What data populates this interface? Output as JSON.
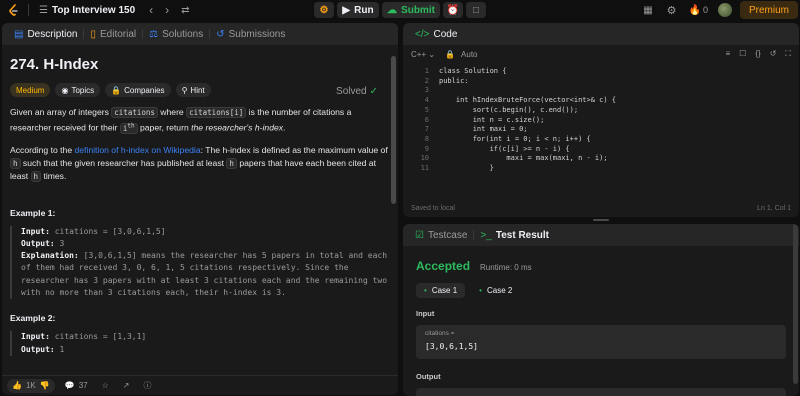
{
  "topbar": {
    "title": "Top Interview 150",
    "run_label": "Run",
    "submit_label": "Submit",
    "streak": "0",
    "premium_label": "Premium"
  },
  "left": {
    "tabs": [
      "Description",
      "Editorial",
      "Solutions",
      "Submissions"
    ],
    "problem_title": "274. H-Index",
    "status": "Solved",
    "tags": {
      "difficulty": "Medium",
      "topics": "Topics",
      "companies": "Companies",
      "hint": "Hint"
    },
    "para1": {
      "t1": "Given an array of integers ",
      "c1": "citations",
      "t2": " where ",
      "c2": "citations[i]",
      "t3": " is the number of citations a researcher received for their ",
      "c3": "i",
      "sup": "th",
      "t4": " paper, return ",
      "em": "the researcher's h-index",
      "t5": "."
    },
    "para2": {
      "t1": "According to the ",
      "link": "definition of h-index on Wikipedia",
      "t2": ": The h-index is defined as the maximum value of ",
      "c1": "h",
      "t3": " such that the given researcher has published at least ",
      "c2": "h",
      "t4": " papers that have each been cited at least ",
      "c3": "h",
      "t5": " times."
    },
    "example1": {
      "title": "Example 1:",
      "input_label": "Input:",
      "input_value": "citations = [3,0,6,1,5]",
      "output_label": "Output:",
      "output_value": "3",
      "explanation_label": "Explanation:",
      "explanation_value": "[3,0,6,1,5] means the researcher has 5 papers in total and each of them had received 3, 0, 6, 1, 5 citations respectively. Since the researcher has 3 papers with at least 3 citations each and the remaining two with no more than 3 citations each, their h-index is 3."
    },
    "example2": {
      "title": "Example 2:",
      "input_label": "Input:",
      "input_value": "citations = [1,3,1]",
      "output_label": "Output:",
      "output_value": "1"
    },
    "footer": {
      "likes": "1K",
      "comments": "37"
    }
  },
  "code": {
    "tab_label": "Code",
    "language": "C++",
    "mode": "Auto",
    "line_numbers": [
      "1",
      "2",
      "3",
      "4",
      "5",
      "6",
      "7",
      "8",
      "9",
      "10",
      "11"
    ],
    "lines": [
      "class Solution {",
      "public:",
      "",
      "    int hIndexBruteForce(vector<int>& c) {",
      "        sort(c.begin(), c.end());",
      "        int n = c.size();",
      "        int maxi = 0;",
      "        for(int i = 0; i < n; i++) {",
      "            if(c[i] >= n - i) {",
      "                maxi = max(maxi, n - i);",
      "            }"
    ],
    "saved_text": "Saved to local",
    "cursor_pos": "Ln 1, Col 1"
  },
  "result": {
    "tabs": [
      "Testcase",
      "Test Result"
    ],
    "verdict": "Accepted",
    "runtime": "Runtime: 0 ms",
    "cases": [
      "Case 1",
      "Case 2"
    ],
    "input_heading": "Input",
    "param_name": "citations =",
    "param_value": "[3,0,6,1,5]",
    "output_heading": "Output"
  },
  "colors": {
    "accent": "#ffa116",
    "accepted": "#2cbb5d",
    "medium": "#ffb800",
    "link": "#3b82f6"
  }
}
